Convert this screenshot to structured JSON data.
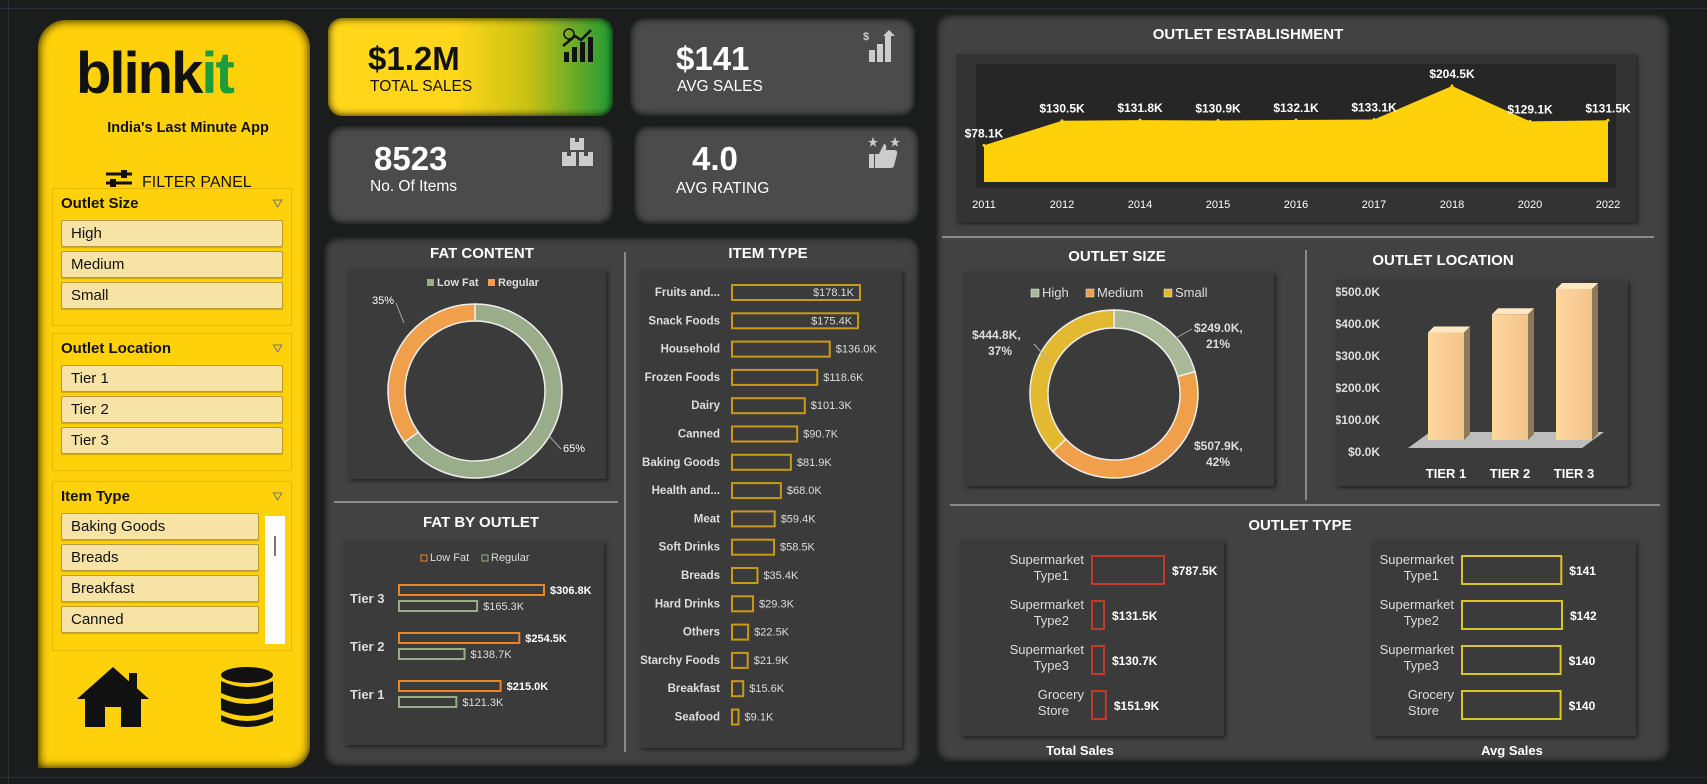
{
  "sidebar": {
    "logo_main": "blink",
    "logo_accent": "it",
    "tagline": "India's Last Minute App",
    "filter_label": "FILTER PANEL",
    "slicers": [
      {
        "title": "Outlet Size",
        "items": [
          "High",
          "Medium",
          "Small"
        ]
      },
      {
        "title": "Outlet Location",
        "items": [
          "Tier 1",
          "Tier 2",
          "Tier 3"
        ]
      },
      {
        "title": "Item Type",
        "items": [
          "Baking Goods",
          "Breads",
          "Breakfast",
          "Canned"
        ]
      }
    ],
    "nav_icons": [
      "home-icon",
      "database-icon"
    ]
  },
  "kpis": [
    {
      "value": "$1.2M",
      "label": "TOTAL SALES",
      "icon": "chart-up-icon"
    },
    {
      "value": "$141",
      "label": "AVG SALES",
      "icon": "bar-growth-icon"
    },
    {
      "value": "8523",
      "label": "No. Of Items",
      "icon": "boxes-icon"
    },
    {
      "value": "4.0",
      "label": "AVG RATING",
      "icon": "thumbs-stars-icon"
    }
  ],
  "colors": {
    "accent": "#ffd10a",
    "panel": "#424242",
    "lowfat": "#9aad8a",
    "regular": "#f0a04b",
    "high": "#a9b998",
    "medium": "#f0a04b",
    "small": "#e2b930"
  },
  "chart_data": [
    {
      "type": "area",
      "title": "OUTLET ESTABLISHMENT",
      "x": [
        "2011",
        "2012",
        "2014",
        "2015",
        "2016",
        "2017",
        "2018",
        "2020",
        "2022"
      ],
      "values": [
        78.1,
        130.5,
        131.8,
        130.9,
        132.1,
        133.1,
        204.5,
        129.1,
        131.5
      ],
      "labels": [
        "$78.1K",
        "$130.5K",
        "$131.8K",
        "$130.9K",
        "$132.1K",
        "$133.1K",
        "$204.5K",
        "$129.1K",
        "$131.5K"
      ]
    },
    {
      "type": "pie",
      "title": "FAT CONTENT",
      "categories": [
        "Low Fat",
        "Regular"
      ],
      "values": [
        65,
        35
      ],
      "labels": [
        "65%",
        "35%"
      ]
    },
    {
      "type": "bar",
      "title": "FAT BY OUTLET",
      "categories": [
        "Tier 3",
        "Tier 2",
        "Tier 1"
      ],
      "series": [
        {
          "name": "Low Fat",
          "values": [
            306.8,
            254.5,
            215.0
          ],
          "labels": [
            "$306.8K",
            "$254.5K",
            "$215.0K"
          ]
        },
        {
          "name": "Regular",
          "values": [
            165.3,
            138.7,
            121.3
          ],
          "labels": [
            "$165.3K",
            "$138.7K",
            "$121.3K"
          ]
        }
      ]
    },
    {
      "type": "bar",
      "title": "ITEM TYPE",
      "categories": [
        "Fruits and...",
        "Snack Foods",
        "Household",
        "Frozen Foods",
        "Dairy",
        "Canned",
        "Baking Goods",
        "Health and...",
        "Meat",
        "Soft Drinks",
        "Breads",
        "Hard Drinks",
        "Others",
        "Starchy Foods",
        "Breakfast",
        "Seafood"
      ],
      "values": [
        178.1,
        175.4,
        136.0,
        118.6,
        101.3,
        90.7,
        81.9,
        68.0,
        59.4,
        58.5,
        35.4,
        29.3,
        22.5,
        21.9,
        15.6,
        9.1
      ],
      "labels": [
        "$178.1K",
        "$175.4K",
        "$136.0K",
        "$118.6K",
        "$101.3K",
        "$90.7K",
        "$81.9K",
        "$68.0K",
        "$59.4K",
        "$58.5K",
        "$35.4K",
        "$29.3K",
        "$22.5K",
        "$21.9K",
        "$15.6K",
        "$9.1K"
      ]
    },
    {
      "type": "pie",
      "title": "OUTLET SIZE",
      "categories": [
        "High",
        "Medium",
        "Small"
      ],
      "values": [
        249.0,
        507.9,
        444.8
      ],
      "labels": [
        "$249.0K,",
        "21%",
        "$507.9K,",
        "42%",
        "$444.8K,",
        "37%"
      ]
    },
    {
      "type": "bar",
      "title": "OUTLET LOCATION",
      "categories": [
        "TIER 1",
        "TIER 2",
        "TIER 3"
      ],
      "values": [
        336,
        393,
        472
      ],
      "yticks": [
        "$0.0K",
        "$100.0K",
        "$200.0K",
        "$300.0K",
        "$400.0K",
        "$500.0K"
      ],
      "ylim": [
        0,
        500
      ]
    },
    {
      "type": "bar",
      "title": "OUTLET TYPE",
      "xlabel": "Total Sales",
      "categories": [
        "Supermarket Type1",
        "Supermarket Type2",
        "Supermarket Type3",
        "Grocery Store"
      ],
      "values": [
        787.5,
        131.5,
        130.7,
        151.9
      ],
      "labels": [
        "$787.5K",
        "$131.5K",
        "$130.7K",
        "$151.9K"
      ]
    },
    {
      "type": "bar",
      "xlabel": "Avg Sales",
      "categories": [
        "Supermarket Type1",
        "Supermarket Type2",
        "Supermarket Type3",
        "Grocery Store"
      ],
      "values": [
        141,
        142,
        140,
        140
      ],
      "labels": [
        "$141",
        "$142",
        "$140",
        "$140"
      ]
    }
  ]
}
